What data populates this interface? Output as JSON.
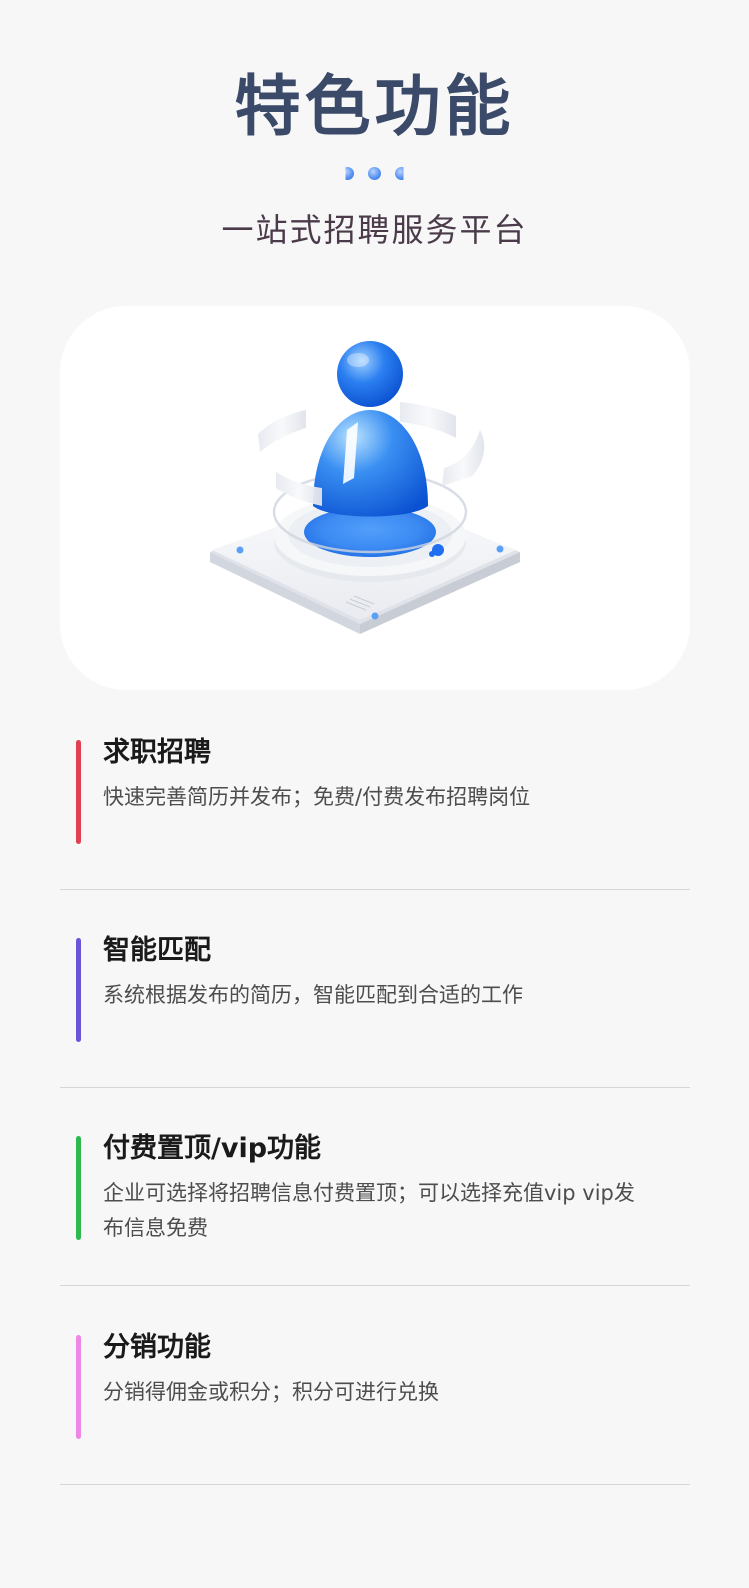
{
  "header": {
    "title": "特色功能",
    "subtitle": "一站式招聘服务平台"
  },
  "hero": {
    "illustration": "user-profile-3d-icon",
    "accent_color": "#2f7cf0"
  },
  "features": [
    {
      "title": "求职招聘",
      "description": "快速完善简历并发布；免费/付费发布招聘岗位",
      "bar_color": "#e0404f"
    },
    {
      "title": "智能匹配",
      "description": "系统根据发布的简历，智能匹配到合适的工作",
      "bar_color": "#6a55d8"
    },
    {
      "title": "付费置顶/vip功能",
      "description": "企业可选择将招聘信息付费置顶；可以选择充值vip vip发布信息免费",
      "bar_color": "#2fb84d"
    },
    {
      "title": "分销功能",
      "description": "分销得佣金或积分；积分可进行兑换",
      "bar_color": "#ee88e6"
    }
  ]
}
